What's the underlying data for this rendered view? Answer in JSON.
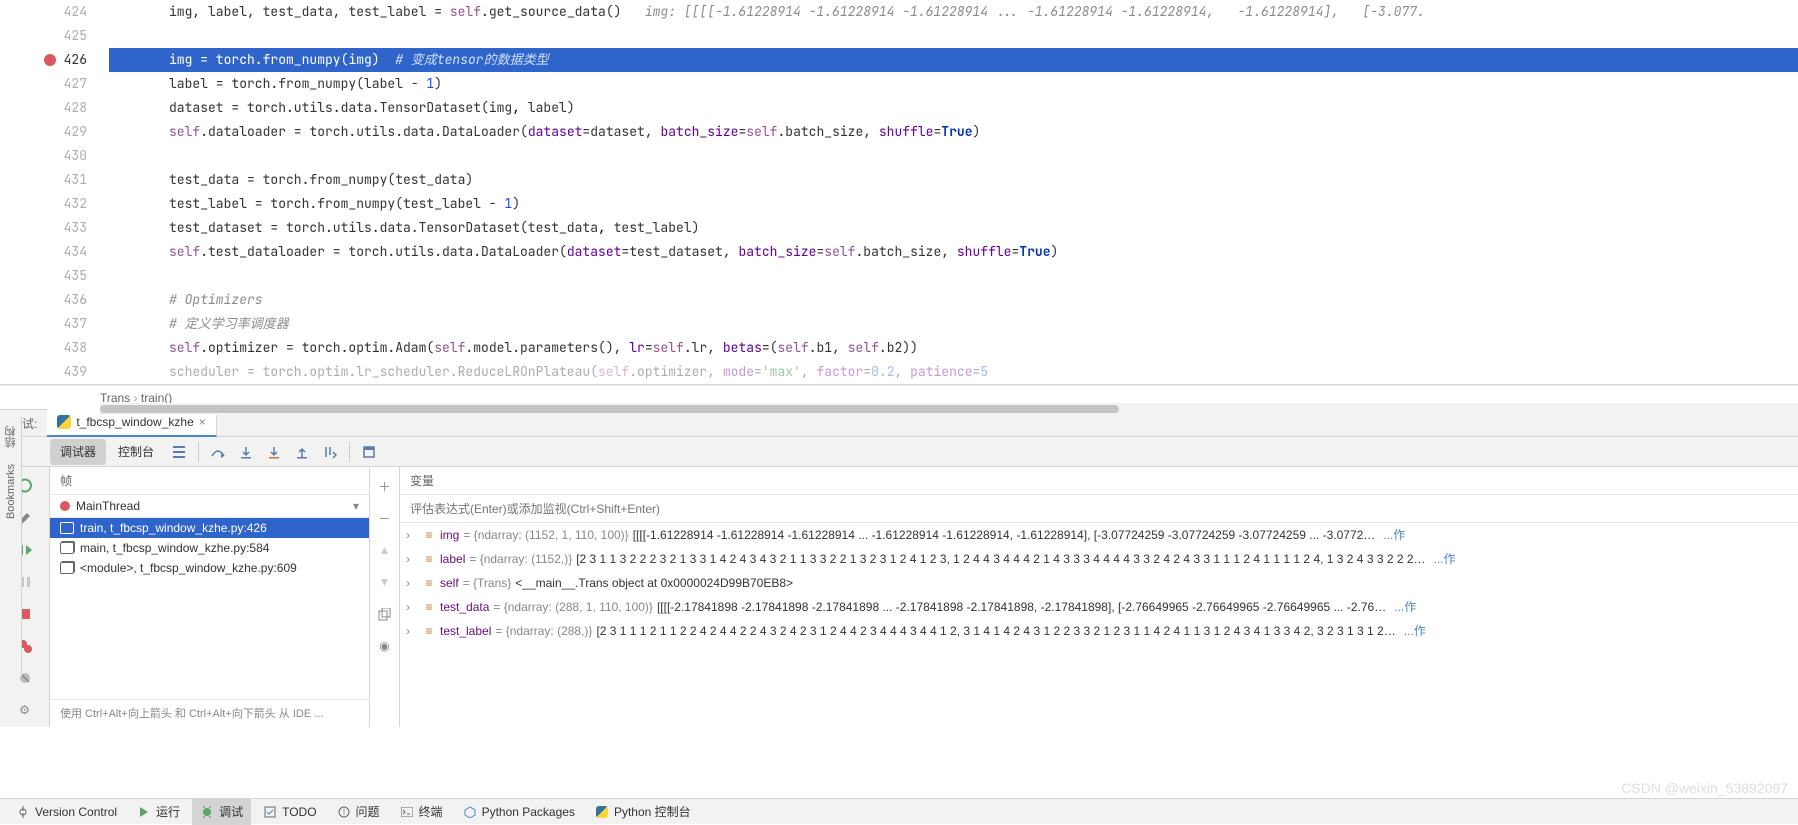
{
  "editor": {
    "lines": [
      {
        "num": "424",
        "html": "img, label, test_data, test_label = <span class='self'>self</span>.get_source_data()   <span class='inlay'>img: [[[[-1.61228914 -1.61228914 -1.61228914 ... -1.61228914 -1.61228914,   -1.61228914],   [-3.077.</span>"
      },
      {
        "num": "425",
        "html": ""
      },
      {
        "num": "426",
        "current": true,
        "breakpoint": true,
        "html": "img = torch.from_numpy(img)  <span class='cmt'># 变成tensor的数据类型</span>"
      },
      {
        "num": "427",
        "html": "label = torch.from_numpy(label - <span class='num'>1</span>)"
      },
      {
        "num": "428",
        "html": "dataset = torch.utils.data.TensorDataset(img<span class='fn'>,</span> label)"
      },
      {
        "num": "429",
        "html": "<span class='self'>self</span>.dataloader = torch.utils.data.DataLoader(<span class='param'>dataset</span>=dataset, <span class='param'>batch_size</span>=<span class='self'>self</span>.batch_size, <span class='param'>shuffle</span>=<span class='kw'>True</span>)"
      },
      {
        "num": "430",
        "html": ""
      },
      {
        "num": "431",
        "html": "test_data = torch.from_numpy(test_data)"
      },
      {
        "num": "432",
        "html": "test_label = torch.from_numpy(test_label - <span class='num'>1</span>)"
      },
      {
        "num": "433",
        "html": "test_dataset = torch.utils.data.TensorDataset(test_data<span class='fn'>,</span> test_label)"
      },
      {
        "num": "434",
        "html": "<span class='self'>self</span>.test_dataloader = torch.utils.data.DataLoader(<span class='param'>dataset</span>=test_dataset, <span class='param'>batch_size</span>=<span class='self'>self</span>.batch_size, <span class='param'>shuffle</span>=<span class='kw'>True</span>)"
      },
      {
        "num": "435",
        "html": ""
      },
      {
        "num": "436",
        "html": "<span class='cmt'># Optimizers</span>"
      },
      {
        "num": "437",
        "html": "<span class='cmt'># 定义学习率调度器</span>"
      },
      {
        "num": "438",
        "html": "<span class='self'>self</span>.optimizer = torch.optim.Adam(<span class='self'>self</span>.model.parameters(), <span class='param'>lr</span>=<span class='self'>self</span>.lr, <span class='param'>betas</span>=(<span class='self'>self</span>.b1, <span class='self'>self</span>.b2))"
      },
      {
        "num": "439",
        "dim": true,
        "html": "<span style='opacity:.4'>scheduler = torch.optim.lr_scheduler.ReduceLROnPlateau(<span class='self'>self</span>.optimizer, <span class='param'>mode</span>=<span class='str'>'max'</span>, <span class='param'>factor</span>=<span class='num'>0.2</span>, <span class='param'>patience</span>=<span class='num'>5</span></span>"
      }
    ]
  },
  "breadcrumb": [
    "Trans",
    "train()"
  ],
  "debug": {
    "label": "调试:",
    "tab_name": "t_fbcsp_window_kzhe",
    "subtabs": {
      "debugger": "调试器",
      "console": "控制台"
    },
    "frames_header": "帧",
    "vars_header": "变量",
    "thread": "MainThread",
    "frames": [
      {
        "label": "train, t_fbcsp_window_kzhe.py:426",
        "selected": true
      },
      {
        "label": "main, t_fbcsp_window_kzhe.py:584"
      },
      {
        "label": "<module>, t_fbcsp_window_kzhe.py:609"
      }
    ],
    "frames_hint": "使用 Ctrl+Alt+向上箭头 和 Ctrl+Alt+向下箭头 从 IDE ",
    "eval_placeholder": "评估表达式(Enter)或添加监视(Ctrl+Shift+Enter)",
    "vars": [
      {
        "name": "img",
        "type": "{ndarray: (1152, 1, 110, 100)}",
        "val": "[[[[-1.61228914 -1.61228914 -1.61228914 ... -1.61228914 -1.61228914,   -1.61228914],   [-3.07724259 -3.07724259 -3.07724259 ... -3.0772…",
        "act": "作"
      },
      {
        "name": "label",
        "type": "{ndarray: (1152,)}",
        "val": "[2 3 1 1 3 2 2 2 3 2 1 3 3 1 4 2 4 3 4 3 2 1 1 3 3 2 2 1 3 2 3 1 2 4 1 2 3, 1 2 4 4 3 4 4 4 2 1 4 3 3 3 4 4 4 4 3 3 2 4 2 4 3 3 1 1 1 2 4 1 1 1 1 2 4, 1 3 2 4 3 3 2 2 2…",
        "act": "作"
      },
      {
        "name": "self",
        "type": "{Trans}",
        "val": "<__main__.Trans object at 0x0000024D99B70EB8>"
      },
      {
        "name": "test_data",
        "type": "{ndarray: (288, 1, 110, 100)}",
        "val": "[[[[-2.17841898 -2.17841898 -2.17841898 ... -2.17841898 -2.17841898,   -2.17841898],   [-2.76649965 -2.76649965 -2.76649965 ... -2.76…",
        "act": "作"
      },
      {
        "name": "test_label",
        "type": "{ndarray: (288,)}",
        "val": "[2 3 1 1 1 2 1 1 2 2 4 2 4 4 2 2 4 3 2 4 2 3 1 2 4 4 2 3 4 4 4 3 4 4 1 2, 3 1 4 1 4 2 4 3 1 2 2 3 3 2 1 2 3 1 1 4 2 4 1 1 3 1 2 4 3 4 1 3 3 4 2, 3 2 3 1 3 1 2…",
        "act": "作"
      }
    ]
  },
  "sidebar": {
    "structure": "结构",
    "bookmarks": "Bookmarks"
  },
  "statusbar": {
    "version_control": "Version Control",
    "run": "运行",
    "debug": "调试",
    "todo": "TODO",
    "problems": "问题",
    "terminal": "终端",
    "python_packages": "Python Packages",
    "python_console": "Python 控制台"
  },
  "watermark": "CSDN @weixin_53892097"
}
